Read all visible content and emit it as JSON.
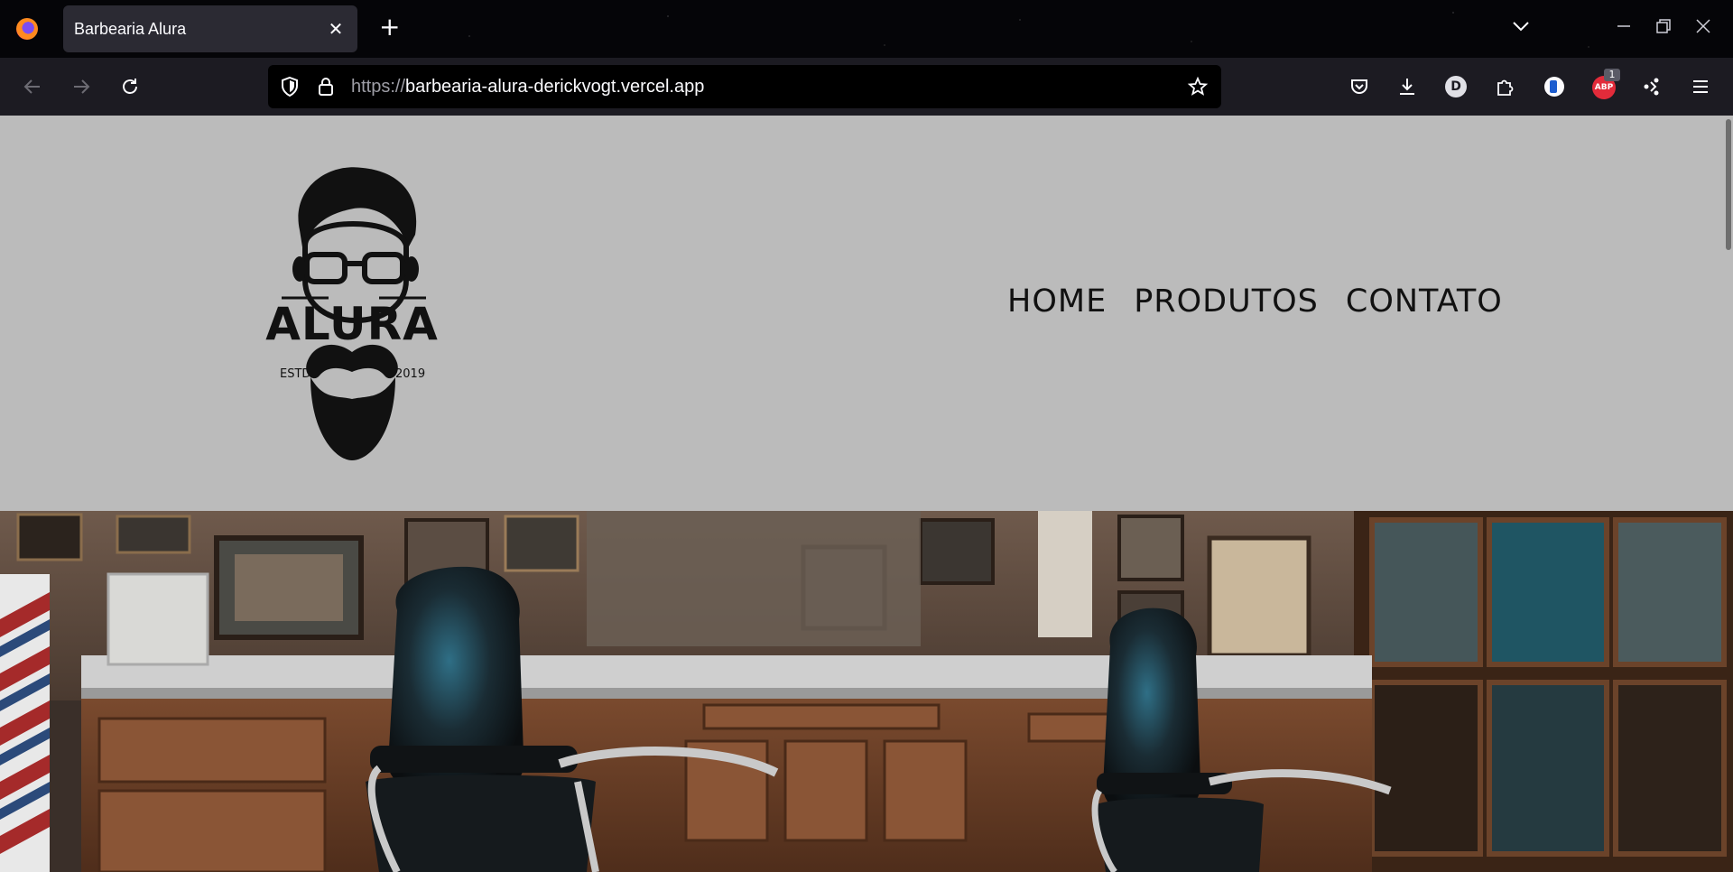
{
  "browser": {
    "tab": {
      "title": "Barbearia Alura"
    },
    "url": {
      "scheme": "https://",
      "host": "barbearia-alura-derickvogt.vercel.app"
    },
    "extension_badge_count": "1",
    "icons": {
      "browser_logo": "firefox-icon",
      "new_tab": "plus-icon",
      "list_tabs": "chevron-down-icon",
      "back": "arrow-left-icon",
      "forward": "arrow-right-icon",
      "reload": "reload-icon",
      "tracking": "shield-icon",
      "lock": "lock-icon",
      "bookmark": "star-icon",
      "pocket": "pocket-icon",
      "downloads": "download-icon",
      "account": "account-icon",
      "extensions": "puzzle-icon",
      "menu": "hamburger-icon"
    },
    "account_initial": "D",
    "adblock_label": "ABP"
  },
  "site": {
    "logo": {
      "name": "ALURA",
      "left_text": "ESTD",
      "right_text": "2019"
    },
    "menu": [
      {
        "label": "HOME"
      },
      {
        "label": "PRODUTOS"
      },
      {
        "label": "CONTATO"
      }
    ],
    "colors": {
      "header_bg": "#bbbbbb",
      "menu_text": "#111111"
    }
  }
}
